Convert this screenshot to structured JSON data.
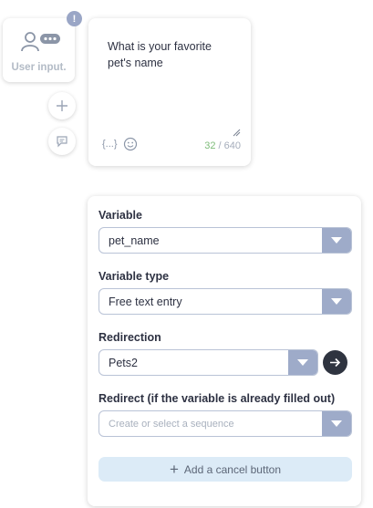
{
  "node": {
    "label": "User input.",
    "alert": "!"
  },
  "message": {
    "text": "What is your favorite pet's name",
    "variable_token": "{...}",
    "char_used": "32",
    "char_sep": " / ",
    "char_max": "640"
  },
  "settings": {
    "variable": {
      "label": "Variable",
      "value": "pet_name"
    },
    "variable_type": {
      "label": "Variable type",
      "value": "Free text entry"
    },
    "redirection": {
      "label": "Redirection",
      "value": "Pets2"
    },
    "redirect_if_filled": {
      "label": "Redirect (if the variable is already filled out)",
      "placeholder": "Create or select a sequence"
    },
    "cancel_button_label": "Add a cancel button"
  },
  "colors": {
    "dropdown": "#9eabc9",
    "go_button": "#2f3440",
    "cancel_button_bg": "#dcebf7",
    "count_used": "#7ebc7a"
  }
}
